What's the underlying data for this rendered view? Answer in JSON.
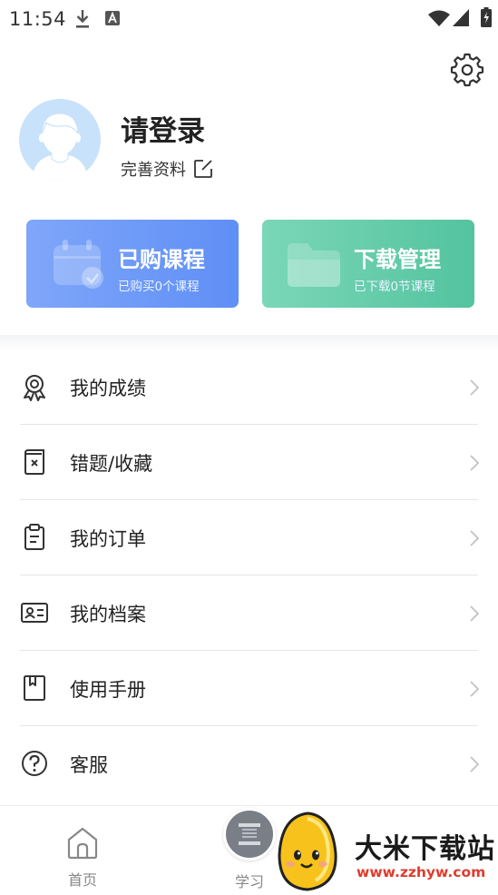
{
  "status_bar": {
    "time": "11:54",
    "icons": [
      "download-icon",
      "a-badge-icon",
      "wifi-icon",
      "signal-icon",
      "battery-icon"
    ]
  },
  "header": {
    "settings_icon": "gear-icon"
  },
  "profile": {
    "title": "请登录",
    "edit_label": "完善资料",
    "avatar_icon": "user-avatar-icon"
  },
  "cards": [
    {
      "title": "已购课程",
      "subtitle": "已购买0个课程",
      "icon": "calendar-check-icon",
      "color": "#6d98f7"
    },
    {
      "title": "下载管理",
      "subtitle": "已下载0节课程",
      "icon": "folder-icon",
      "color": "#62c9a7"
    }
  ],
  "menu": [
    {
      "label": "我的成绩",
      "icon": "medal-icon"
    },
    {
      "label": "错题/收藏",
      "icon": "mistakes-icon"
    },
    {
      "label": "我的订单",
      "icon": "clipboard-icon"
    },
    {
      "label": "我的档案",
      "icon": "id-card-icon"
    },
    {
      "label": "使用手册",
      "icon": "manual-icon"
    },
    {
      "label": "客服",
      "icon": "help-icon"
    }
  ],
  "bottom_nav": [
    {
      "label": "首页",
      "icon": "home-icon"
    },
    {
      "label": "学习",
      "icon": "study-icon"
    }
  ],
  "watermark": {
    "title": "大米下载站",
    "url": "www.zzhyw.com"
  }
}
